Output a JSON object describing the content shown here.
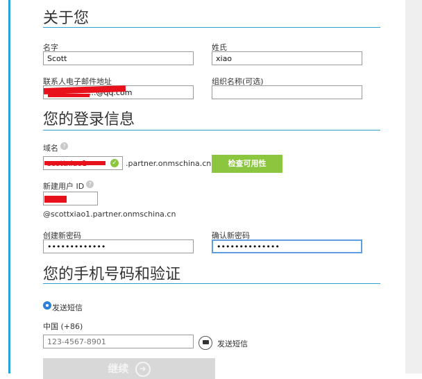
{
  "sections": {
    "about": {
      "title": "关于您"
    },
    "login": {
      "title": "您的登录信息"
    },
    "phone": {
      "title": "您的手机号码和验证"
    }
  },
  "about": {
    "first_name": {
      "label": "名字",
      "value": "Scott"
    },
    "last_name": {
      "label": "姓氏",
      "value": "xiao"
    },
    "email": {
      "label": "联系人电子邮件地址",
      "value": ".....@qq.com"
    },
    "org": {
      "label": "组织名称(可选)",
      "value": ""
    }
  },
  "login": {
    "domain": {
      "label": "域名",
      "value": "scottxiao1",
      "suffix": ".partner.onmschina.cn",
      "check_button": "检查可用性"
    },
    "user_id": {
      "label": "新建用户 ID",
      "value": "scott",
      "full": "@scottxiao1.partner.onmschina.cn"
    },
    "password": {
      "label": "创建新密码",
      "value": "•••••••••••••"
    },
    "confirm": {
      "label": "确认新密码",
      "value": "••••••••••••••"
    }
  },
  "phone": {
    "send_sms_radio": "发送短信",
    "country": "中国 (+86)",
    "number_placeholder": "123-4567-8901",
    "send_sms_link": "发送短信"
  },
  "continue_button": "继续",
  "colors": {
    "accent": "#2aa3d8",
    "green": "#8cc63f",
    "focus": "#5b9ddf"
  }
}
